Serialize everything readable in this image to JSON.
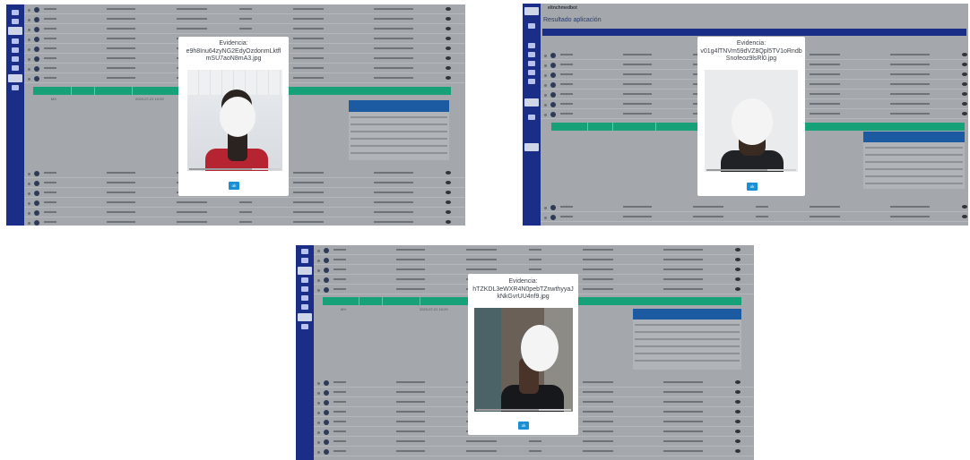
{
  "screenshots": [
    {
      "modal": {
        "title_line1": "Evidencia:",
        "title_line2": "e9h8Inu64zyNG2EdyOzdonmLktfl",
        "title_line3": "mSU7aoN8mA3.jpg",
        "ok_label": "ok"
      }
    },
    {
      "header": {
        "logo_text": "eltnchmedbot",
        "page_title": "Resultado aplicación"
      },
      "modal": {
        "title_line1": "Evidencia:",
        "title_line2": "v01g4lTNVm59dVZ8Qpl5TV1oRndb",
        "title_line3": "Snofeoz9lsRl0.jpg",
        "ok_label": "ok"
      }
    },
    {
      "modal": {
        "title_line1": "Evidencia:",
        "title_line2": "hTZKDL3eWXR4N0pebTZnwthyyaJ",
        "title_line3": "kNkGvrUU4nf9.jpg",
        "ok_label": "ok"
      }
    }
  ],
  "icons": [
    "eye-icon",
    "status-dot-icon",
    "menu-icon"
  ],
  "colors": {
    "sidebar": "#1a2e87",
    "table_header_green": "#17a178",
    "table_header_blue": "#1c5aa2",
    "ok_button": "#1b8fd3"
  }
}
